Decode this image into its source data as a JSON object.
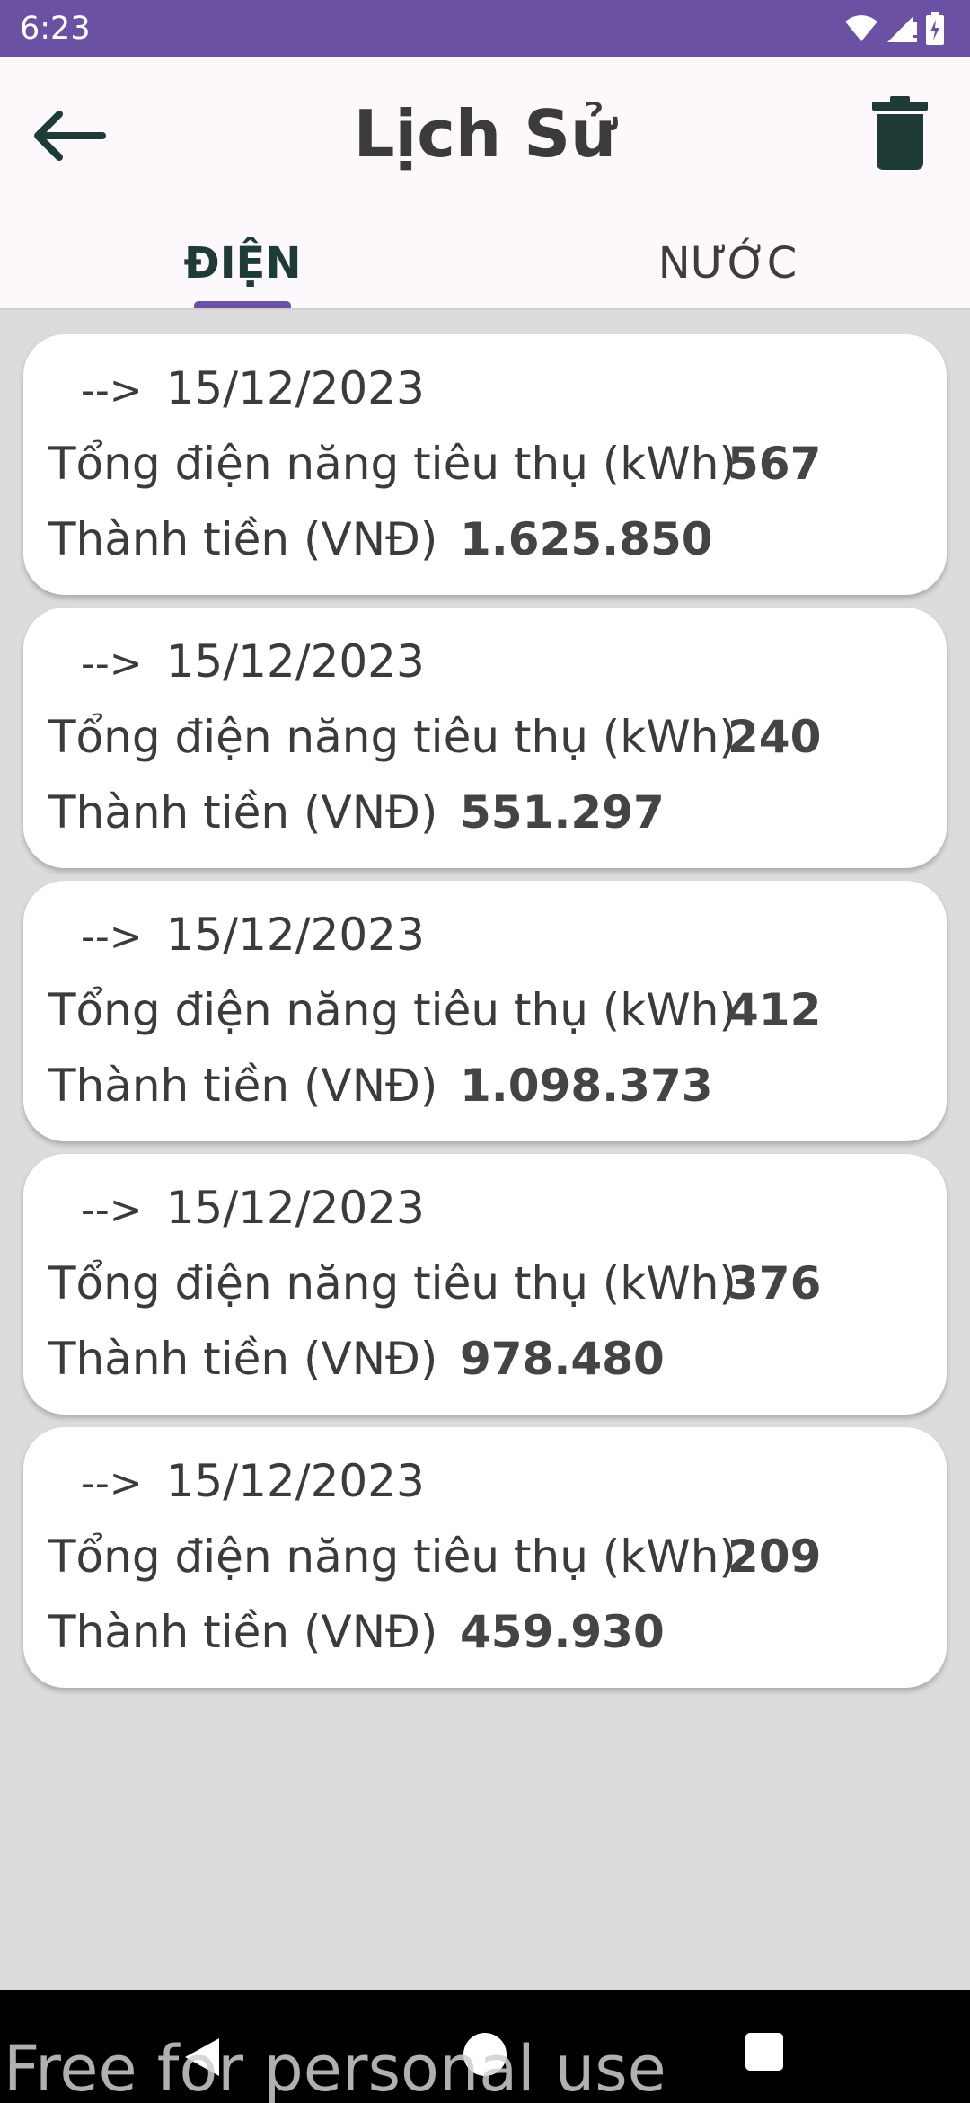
{
  "status_bar": {
    "time": "6:23",
    "icons": [
      "wifi-icon",
      "signal-icon",
      "battery-icon"
    ],
    "background": "#6a51a4"
  },
  "header": {
    "title": "Lịch Sử",
    "back_icon": "arrow-left-icon",
    "delete_icon": "trash-icon"
  },
  "tabs": [
    {
      "label": "ĐIỆN",
      "active": true
    },
    {
      "label": "NƯỚC",
      "active": false
    }
  ],
  "accent_color": "#6a51a4",
  "records": [
    {
      "arrow": "-->",
      "date": "15/12/2023",
      "energy_label": "Tổng điện năng tiêu thụ (kWh)",
      "energy": "567",
      "cost_label": "Thành tiền (VNĐ)",
      "cost": "1.625.850"
    },
    {
      "arrow": "-->",
      "date": "15/12/2023",
      "energy_label": "Tổng điện năng tiêu thụ (kWh)",
      "energy": "240",
      "cost_label": "Thành tiền (VNĐ)",
      "cost": "551.297"
    },
    {
      "arrow": "-->",
      "date": "15/12/2023",
      "energy_label": "Tổng điện năng tiêu thụ (kWh)",
      "energy": "412",
      "cost_label": "Thành tiền (VNĐ)",
      "cost": "1.098.373"
    },
    {
      "arrow": "-->",
      "date": "15/12/2023",
      "energy_label": "Tổng điện năng tiêu thụ (kWh)",
      "energy": "376",
      "cost_label": "Thành tiền (VNĐ)",
      "cost": "978.480"
    },
    {
      "arrow": "-->",
      "date": "15/12/2023",
      "energy_label": "Tổng điện năng tiêu thụ (kWh)",
      "energy": "209",
      "cost_label": "Thành tiền (VNĐ)",
      "cost": "459.930"
    }
  ],
  "nav_bar": {
    "icons": [
      "back-triangle-icon",
      "home-circle-icon",
      "recents-square-icon"
    ]
  },
  "watermark": "Free for personal use"
}
